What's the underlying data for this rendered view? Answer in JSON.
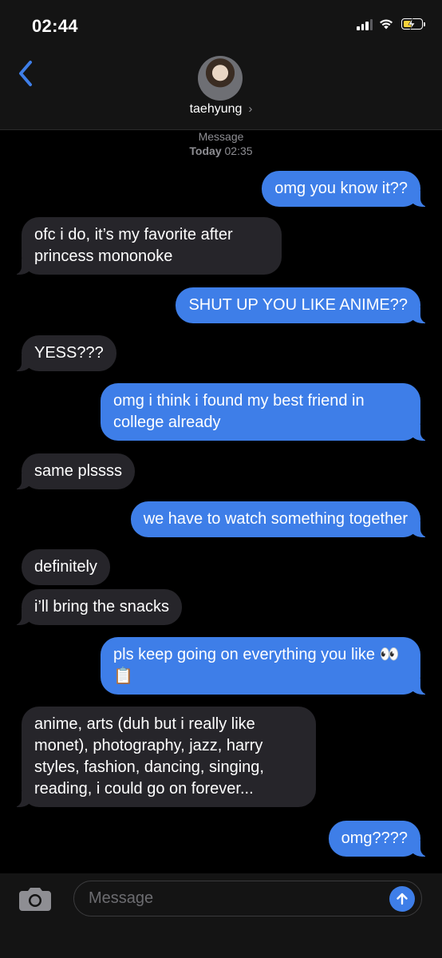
{
  "status": {
    "time": "02:44"
  },
  "header": {
    "contact_name": "taehyung",
    "chevron": "›"
  },
  "meta": {
    "service": "Message",
    "day": "Today",
    "time": "02:35"
  },
  "messages": [
    {
      "side": "out",
      "text": "omg you know it??"
    },
    {
      "side": "in",
      "text": "ofc i do, it’s my favorite after princess mononoke"
    },
    {
      "side": "out",
      "text": "SHUT UP YOU LIKE ANIME??"
    },
    {
      "side": "in",
      "text": "YESS???"
    },
    {
      "side": "out",
      "text": "omg i think i found my best friend in college already"
    },
    {
      "side": "in",
      "text": "same plssss"
    },
    {
      "side": "out",
      "text": "we have to watch something together"
    },
    {
      "side": "in",
      "text": "definitely"
    },
    {
      "side": "in",
      "text": "i’ll bring the snacks"
    },
    {
      "side": "out",
      "text": "pls keep going on everything you like 👀📋"
    },
    {
      "side": "in",
      "text": "anime, arts (duh but i really like monet), photography, jazz, harry styles, fashion, dancing, singing, reading, i could go on forever..."
    },
    {
      "side": "out",
      "text": "omg????"
    }
  ],
  "composer": {
    "placeholder": "Message"
  },
  "icons": {
    "back": "chevron-left-icon",
    "camera": "camera-icon",
    "send": "arrow-up-icon",
    "signal": "signal-icon",
    "wifi": "wifi-icon",
    "battery": "battery-charging-icon"
  },
  "colors": {
    "outgoing": "#3e7ee8",
    "incoming": "#26252a",
    "accent": "#3e7ee8",
    "battery": "#f6d23a"
  }
}
